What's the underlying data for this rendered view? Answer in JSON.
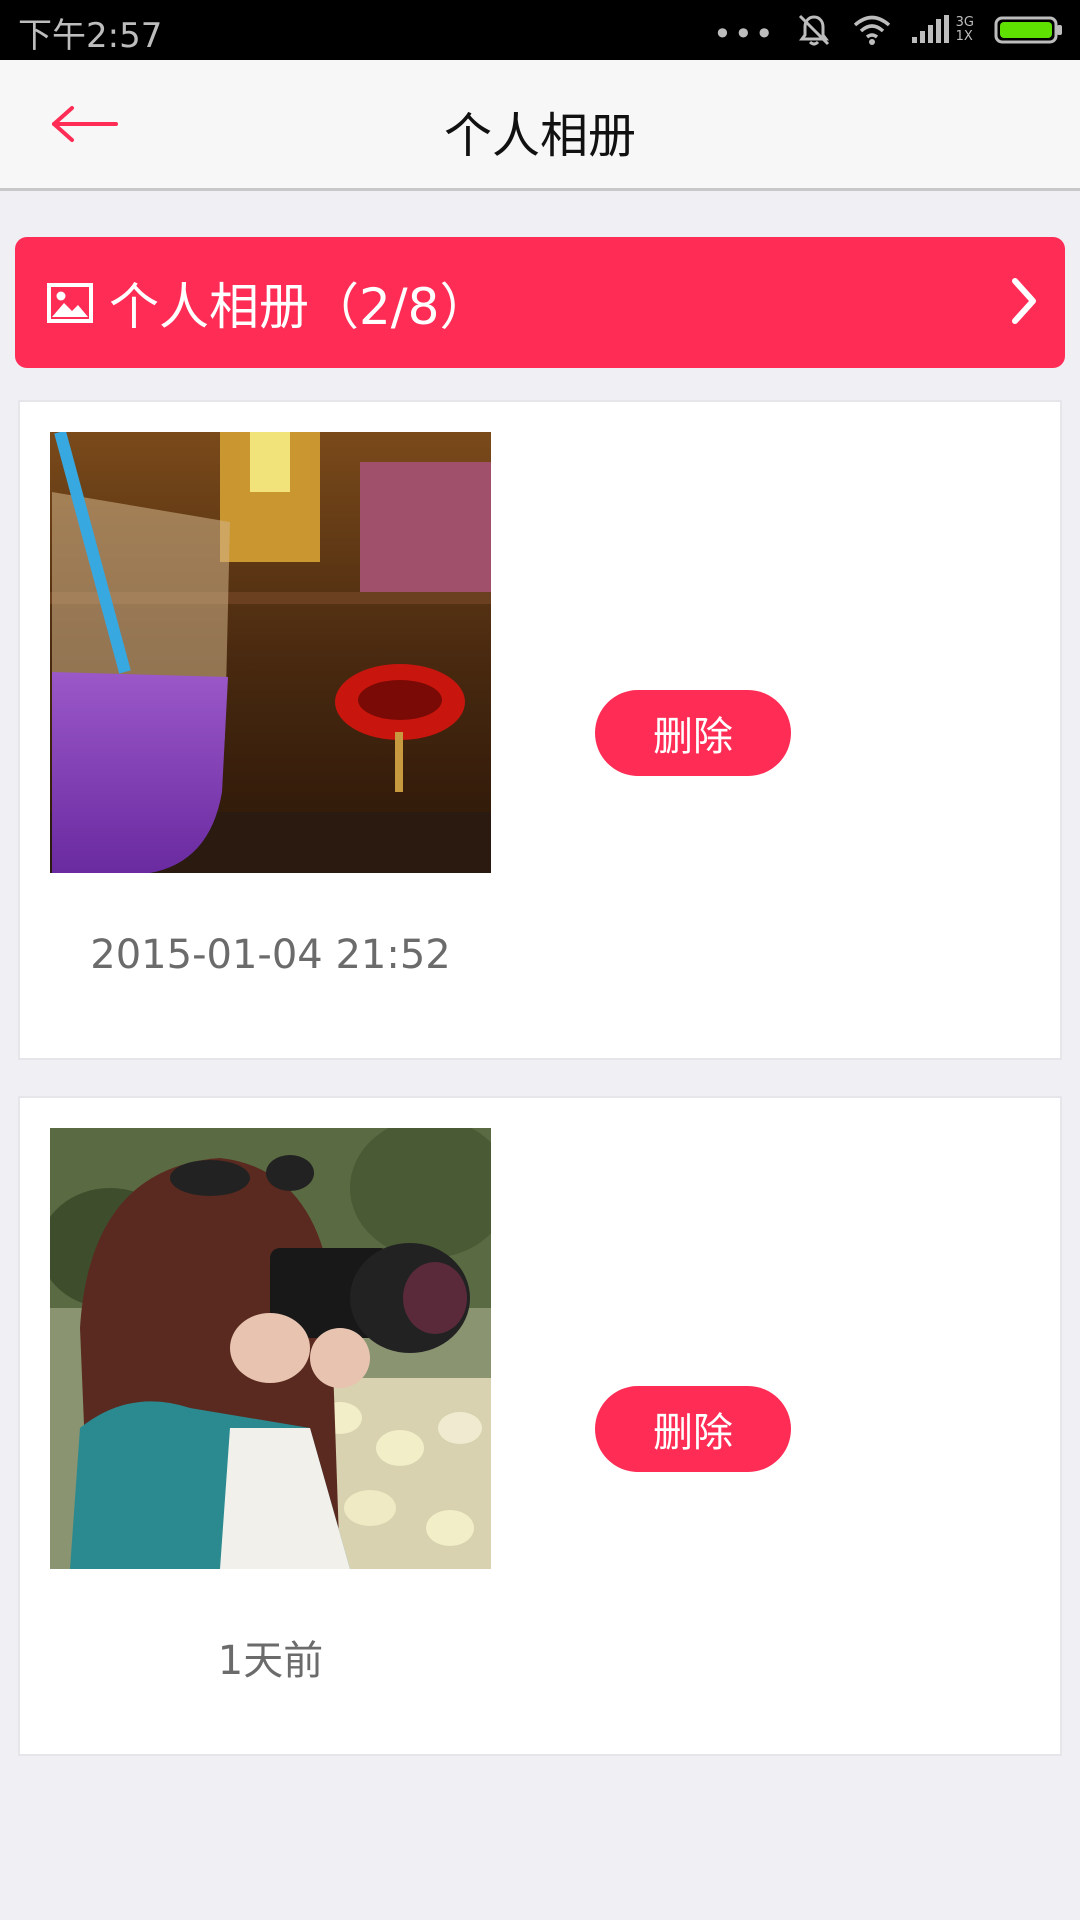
{
  "status_bar": {
    "time": "下午2:57",
    "network_top": "3G",
    "network_bottom": "1X",
    "icons": [
      "more-dots-icon",
      "mute-bell-icon",
      "wifi-icon",
      "signal-icon",
      "battery-icon"
    ]
  },
  "nav": {
    "title": "个人相册",
    "back_icon": "back-arrow-icon"
  },
  "album": {
    "title": "个人相册",
    "count": "（2/8）",
    "icon": "image-icon",
    "chevron_icon": "chevron-right-icon"
  },
  "photos": [
    {
      "time": "2015-01-04 21:52",
      "delete_label": "删除"
    },
    {
      "time": "1天前",
      "delete_label": "删除"
    }
  ],
  "colors": {
    "accent": "#ff2c55",
    "background": "#efeff4",
    "status_bar": "#000000",
    "nav_bar": "#f7f7f7"
  }
}
